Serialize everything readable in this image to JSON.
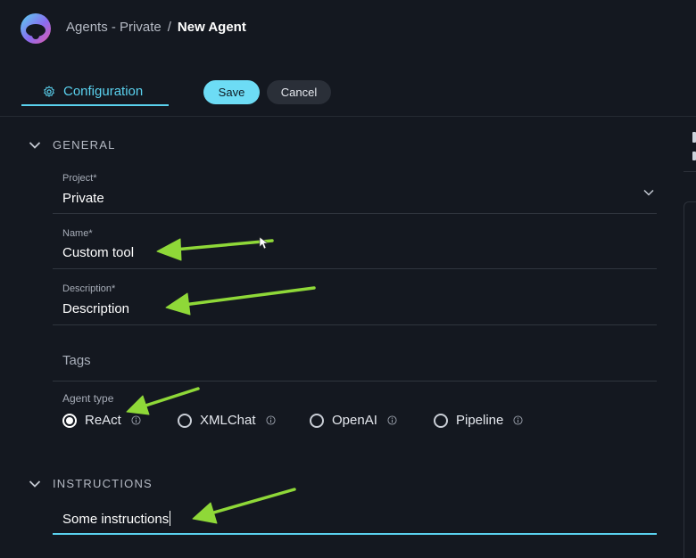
{
  "breadcrumb": {
    "parent": "Agents - Private",
    "separator": "/",
    "current": "New Agent"
  },
  "tabs": [
    {
      "label": "Configuration",
      "icon": "gear-icon",
      "active": true
    }
  ],
  "toolbar": {
    "save_label": "Save",
    "cancel_label": "Cancel"
  },
  "sections": {
    "general": {
      "title": "GENERAL",
      "project": {
        "label": "Project*",
        "value": "Private"
      },
      "name": {
        "label": "Name*",
        "value": "Custom tool"
      },
      "description": {
        "label": "Description*",
        "value": "Description"
      },
      "tags": {
        "placeholder": "Tags"
      },
      "agent_type": {
        "label": "Agent type",
        "options": [
          {
            "label": "ReAct",
            "selected": true
          },
          {
            "label": "XMLChat",
            "selected": false
          },
          {
            "label": "OpenAI",
            "selected": false
          },
          {
            "label": "Pipeline",
            "selected": false
          }
        ]
      }
    },
    "instructions": {
      "title": "INSTRUCTIONS",
      "value": "Some instructions"
    }
  },
  "colors": {
    "accent": "#5ad1ee",
    "save_button": "#6ddcf5",
    "background": "#141820",
    "annotation_arrow": "#8fd838"
  }
}
